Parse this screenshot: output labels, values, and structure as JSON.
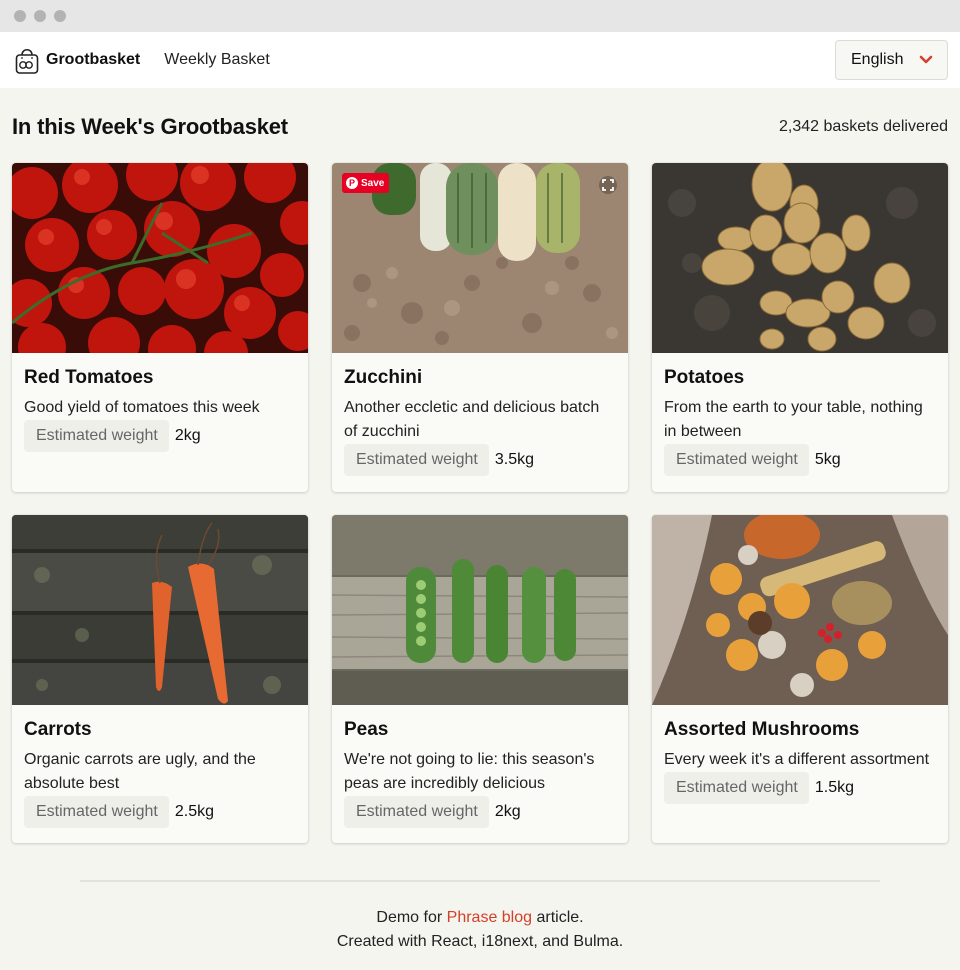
{
  "nav": {
    "brand": "Grootbasket",
    "link": "Weekly Basket",
    "language": "English"
  },
  "section": {
    "title": "In this Week's Grootbasket",
    "deliveries": "2,342 baskets delivered"
  },
  "weight_label": "Estimated weight",
  "cards": [
    {
      "title": "Red Tomatoes",
      "description": "Good yield of tomatoes this week",
      "weight": "2kg"
    },
    {
      "title": "Zucchini",
      "description": "Another eccletic and delicious batch of zucchini",
      "weight": "3.5kg",
      "pin_label": "Save"
    },
    {
      "title": "Potatoes",
      "description": "From the earth to your table, nothing in between",
      "weight": "5kg"
    },
    {
      "title": "Carrots",
      "description": "Organic carrots are ugly, and the absolute best",
      "weight": "2.5kg"
    },
    {
      "title": "Peas",
      "description": "We're not going to lie: this season's peas are incredibly delicious",
      "weight": "2kg"
    },
    {
      "title": "Assorted Mushrooms",
      "description": "Every week it's a different assortment",
      "weight": "1.5kg"
    }
  ],
  "footer": {
    "line1_prefix": "Demo for ",
    "line1_link": "Phrase blog",
    "line1_suffix": " article.",
    "line2": "Created with React, i18next, and Bulma."
  },
  "colors": {
    "accent": "#d4402a",
    "page_bg": "#f5f5f0",
    "pinterest": "#e60023"
  }
}
